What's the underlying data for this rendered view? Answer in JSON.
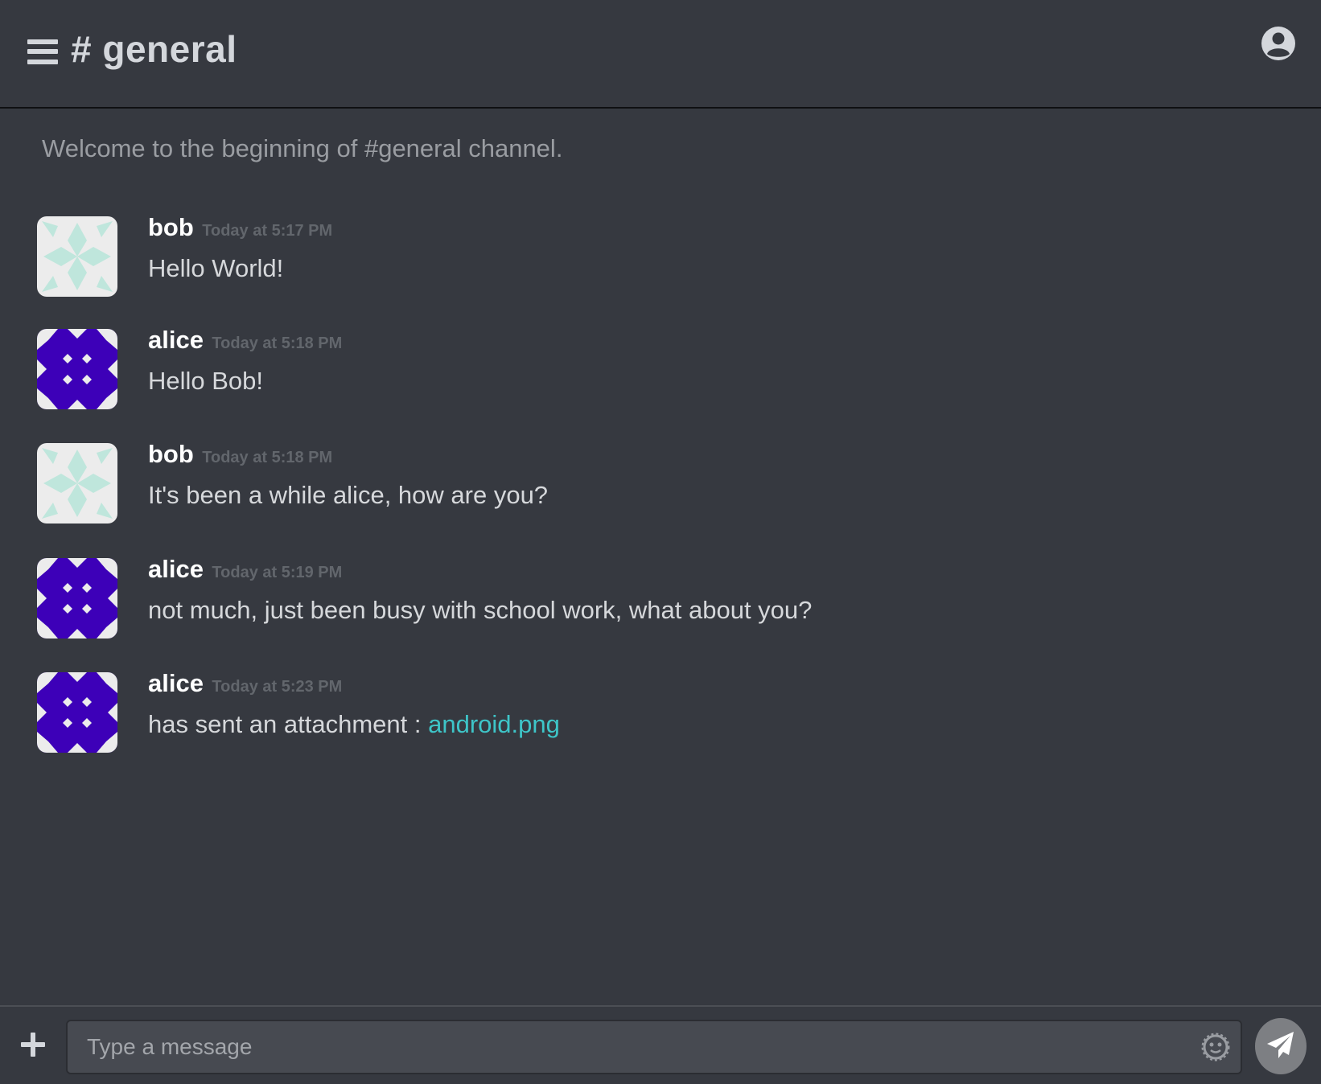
{
  "header": {
    "channel_title": "# general"
  },
  "main": {
    "welcome": "Welcome to the beginning of #general channel.",
    "messages": [
      {
        "author": "bob",
        "time": "Today at 5:17 PM",
        "text": "Hello World!"
      },
      {
        "author": "alice",
        "time": "Today at 5:18 PM",
        "text": "Hello Bob!"
      },
      {
        "author": "bob",
        "time": "Today at 5:18 PM",
        "text": "It's been a while alice, how are you?"
      },
      {
        "author": "alice",
        "time": "Today at 5:19 PM",
        "text": "not much, just been busy with school work, what about you?"
      },
      {
        "author": "alice",
        "time": "Today at 5:23 PM",
        "text": "has sent an attachment : ",
        "attachment": "android.png"
      }
    ]
  },
  "composer": {
    "placeholder": "Type a message"
  },
  "icons": {
    "menu": "hamburger-menu-icon",
    "profile": "user-circle-icon",
    "add": "plus-icon",
    "emoji": "emoji-icon",
    "send": "paper-plane-icon"
  },
  "colors": {
    "background": "#363940",
    "link": "#3ec5c8",
    "bob_avatar": "#bfe6dc",
    "alice_avatar": "#3d00b8"
  }
}
